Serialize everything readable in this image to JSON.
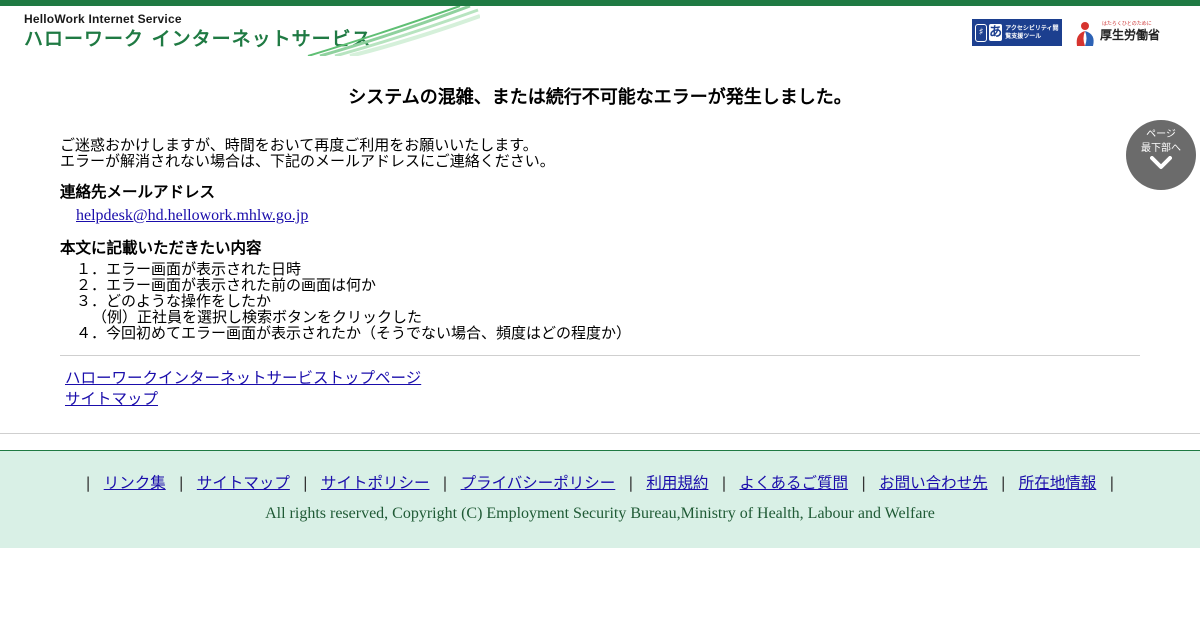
{
  "header": {
    "logo_en": "HelloWork Internet Service",
    "logo_jp": "ハローワーク インターネットサービス",
    "accessibility_badge": "アクセシビリティ閲覧支援ツール",
    "ministry_logo": "厚生労働省",
    "ministry_tagline": "はたらくひとのために"
  },
  "main": {
    "title": "システムの混雑、または続行不可能なエラーが発生しました。",
    "intro": [
      "ご迷惑おかけしますが、時間をおいて再度ご利用をお願いいたします。",
      "エラーが解消されない場合は、下記のメールアドレスにご連絡ください。"
    ],
    "contact_heading": "連絡先メールアドレス",
    "contact_email": "helpdesk@hd.hellowork.mhlw.go.jp",
    "content_heading": "本文に記載いただきたい内容",
    "content_items": [
      "１．エラー画面が表示された日時",
      "２．エラー画面が表示された前の画面は何か",
      "３．どのような操作をしたか",
      "（例）正社員を選択し検索ボタンをクリックした",
      "４．今回初めてエラー画面が表示されたか（そうでない場合、頻度はどの程度か）"
    ],
    "links": [
      "ハローワークインターネットサービストップページ",
      "サイトマップ"
    ]
  },
  "scroll_button": {
    "line1": "ページ",
    "line2": "最下部へ",
    "icon": "chevron-down-icon"
  },
  "footer": {
    "nav": [
      "リンク集",
      "サイトマップ",
      "サイトポリシー",
      "プライバシーポリシー",
      "利用規約",
      "よくあるご質問",
      "お問い合わせ先",
      "所在地情報"
    ],
    "separator": "|",
    "copyright": "All rights reserved, Copyright (C) Employment Security Bureau,Ministry of Health, Labour and Welfare"
  },
  "colors": {
    "brand_green": "#1f7a43",
    "footer_bg": "#d9f0e6",
    "link": "#1a0dab",
    "scroll_button_bg": "#6b6b6b"
  }
}
